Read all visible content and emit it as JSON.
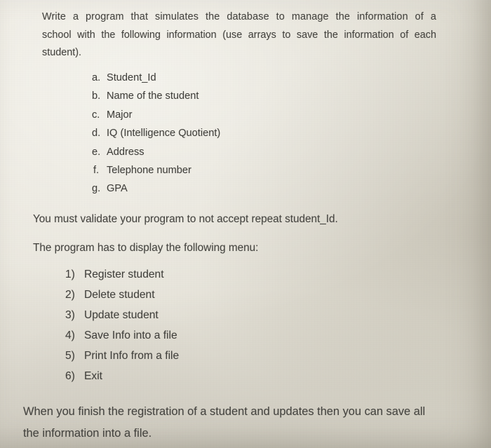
{
  "document": {
    "type": "scanned-assignment-page",
    "paper_color": "#e4e1d7",
    "ink_color": "#403f3b",
    "intro_paragraph": {
      "line1": "Write a program that simulates the database to manage the information of a",
      "line2": "school with the following information (use arrays to save the information of each",
      "line3": "student)."
    },
    "fields_list": [
      {
        "marker": "a.",
        "label": "Student_Id"
      },
      {
        "marker": "b.",
        "label": "Name of the student"
      },
      {
        "marker": "c.",
        "label": "Major"
      },
      {
        "marker": "d.",
        "label": "IQ (Intelligence Quotient)"
      },
      {
        "marker": "e.",
        "label": "Address"
      },
      {
        "marker": "f.",
        "label": "Telephone number"
      },
      {
        "marker": "g.",
        "label": "GPA"
      }
    ],
    "validation_note": "You must validate your program to not accept repeat student_Id.",
    "menu_intro": "The program has to display the following menu:",
    "menu_list": [
      {
        "marker": "1)",
        "label": "Register student"
      },
      {
        "marker": "2)",
        "label": "Delete student"
      },
      {
        "marker": "3)",
        "label": "Update student"
      },
      {
        "marker": "4)",
        "label": "Save Info into a file"
      },
      {
        "marker": "5)",
        "label": "Print Info from a file"
      },
      {
        "marker": "6)",
        "label": "Exit"
      }
    ],
    "closing_paragraph": {
      "line1": "When you finish the registration of a student and updates then you can save all",
      "line2": "the information into a file."
    }
  }
}
